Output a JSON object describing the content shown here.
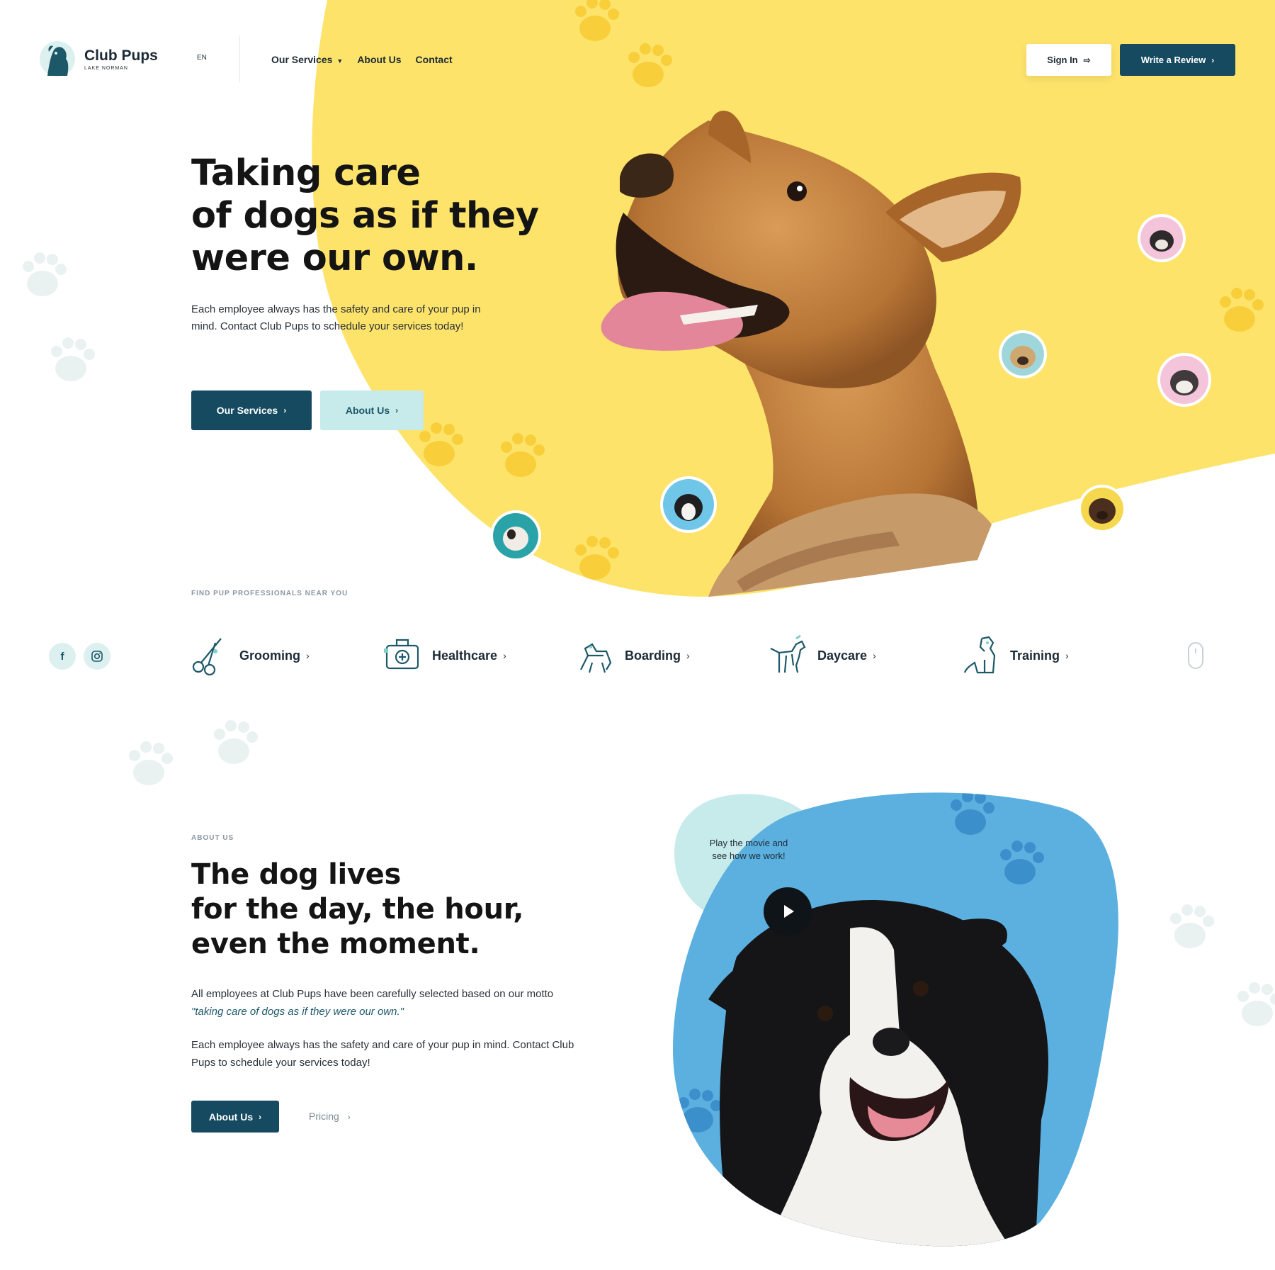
{
  "brand": {
    "name": "Club Pups",
    "tagline": "LAKE NORMAN",
    "language": "EN"
  },
  "nav": {
    "items": [
      {
        "label": "Our Services",
        "has_dropdown": true
      },
      {
        "label": "About Us",
        "has_dropdown": false
      },
      {
        "label": "Contact",
        "has_dropdown": false
      }
    ],
    "sign_in_label": "Sign In",
    "write_review_label": "Write a Review"
  },
  "hero": {
    "title_lines": [
      "Taking care",
      "of dogs as if they",
      "were our own."
    ],
    "description": "Each employee always has the safety and care of your pup in mind. Contact Club Pups to schedule your services today!",
    "primary_button": "Our Services",
    "secondary_button": "About Us"
  },
  "services": {
    "label": "FIND PUP PROFESSIONALS NEAR YOU",
    "social": [
      "f",
      "instagram"
    ],
    "items": [
      {
        "label": "Grooming",
        "icon": "grooming-scissors-icon"
      },
      {
        "label": "Healthcare",
        "icon": "healthcare-kit-icon"
      },
      {
        "label": "Boarding",
        "icon": "boarding-dog-icon"
      },
      {
        "label": "Daycare",
        "icon": "daycare-dog-icon"
      },
      {
        "label": "Training",
        "icon": "training-dog-icon"
      }
    ]
  },
  "about": {
    "label": "ABOUT US",
    "title_lines": [
      "The dog lives",
      "for the day, the hour,",
      "even the moment."
    ],
    "paragraph1_prefix": "All employees at Club Pups have been carefully selected based on our motto ",
    "paragraph1_motto": "\"taking care of dogs as if they were our own.\"",
    "paragraph2": "Each employee always has the safety and care of your pup in mind. Contact Club Pups to schedule your services today!",
    "button": "About Us",
    "pricing_link": "Pricing",
    "movie_text": "Play the movie and see how we work!"
  },
  "colors": {
    "primary": "#154a60",
    "hero_yellow": "#fde36a",
    "mint": "#c7eaea",
    "about_blue": "#5bb0e0",
    "text_dark": "#141414"
  }
}
